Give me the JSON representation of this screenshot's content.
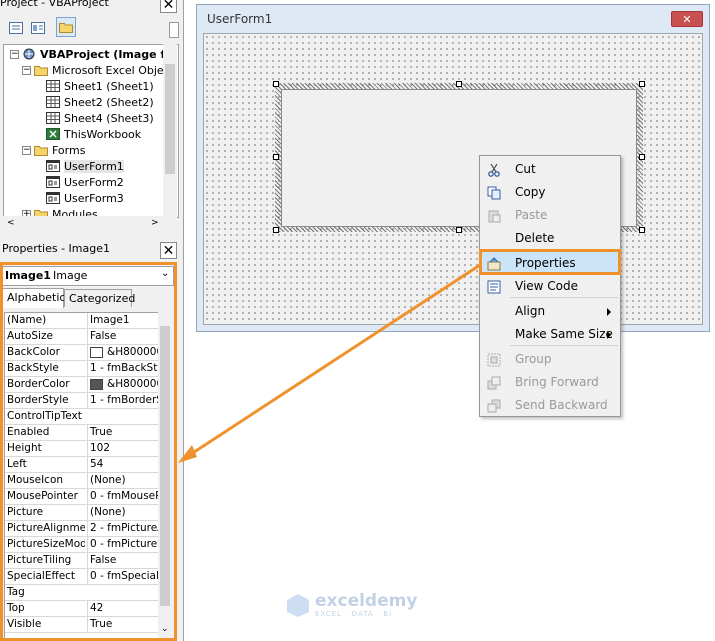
{
  "project": {
    "title": "Project - VBAProject",
    "tree": [
      {
        "label": "VBAProject (Image f",
        "icon": "vba-project-icon",
        "bold": true,
        "level": 0,
        "expander": "−"
      },
      {
        "label": "Microsoft Excel Obje",
        "icon": "folder-icon",
        "level": 1,
        "expander": "−"
      },
      {
        "label": "Sheet1 (Sheet1)",
        "icon": "sheet-icon",
        "level": 2
      },
      {
        "label": "Sheet2 (Sheet2)",
        "icon": "sheet-icon",
        "level": 2
      },
      {
        "label": "Sheet4 (Sheet3)",
        "icon": "sheet-icon",
        "level": 2
      },
      {
        "label": "ThisWorkbook",
        "icon": "workbook-icon",
        "level": 2
      },
      {
        "label": "Forms",
        "icon": "folder-icon",
        "level": 1,
        "expander": "−"
      },
      {
        "label": "UserForm1",
        "icon": "userform-icon",
        "level": 2
      },
      {
        "label": "UserForm2",
        "icon": "userform-icon",
        "level": 2
      },
      {
        "label": "UserForm3",
        "icon": "userform-icon",
        "level": 2
      },
      {
        "label": "Modules",
        "icon": "folder-icon",
        "level": 1,
        "expander": "+"
      }
    ]
  },
  "properties": {
    "title": "Properties - Image1",
    "object_name": "Image1",
    "object_type": "Image",
    "tabs": [
      "Alphabetic",
      "Categorized"
    ],
    "rows": [
      {
        "name": "(Name)",
        "value": "Image1"
      },
      {
        "name": "AutoSize",
        "value": "False"
      },
      {
        "name": "BackColor",
        "value": "&H8000000",
        "swatch": "#ffffff"
      },
      {
        "name": "BackStyle",
        "value": "1 - fmBackStyle"
      },
      {
        "name": "BorderColor",
        "value": "&H8000000",
        "swatch": "#555555"
      },
      {
        "name": "BorderStyle",
        "value": "1 - fmBorderSt"
      },
      {
        "name": "ControlTipText",
        "value": ""
      },
      {
        "name": "Enabled",
        "value": "True"
      },
      {
        "name": "Height",
        "value": "102"
      },
      {
        "name": "Left",
        "value": "54"
      },
      {
        "name": "MouseIcon",
        "value": "(None)"
      },
      {
        "name": "MousePointer",
        "value": "0 - fmMousePo"
      },
      {
        "name": "Picture",
        "value": "(None)"
      },
      {
        "name": "PictureAlignment",
        "value": "2 - fmPictureAl"
      },
      {
        "name": "PictureSizeMode",
        "value": "0 - fmPictureSi"
      },
      {
        "name": "PictureTiling",
        "value": "False"
      },
      {
        "name": "SpecialEffect",
        "value": "0 - fmSpecialEf"
      },
      {
        "name": "Tag",
        "value": ""
      },
      {
        "name": "Top",
        "value": "42"
      },
      {
        "name": "Visible",
        "value": "True"
      }
    ]
  },
  "userform": {
    "title": "UserForm1"
  },
  "context_menu": {
    "items": [
      {
        "label": "Cut",
        "icon": "scissors-icon",
        "enabled": true
      },
      {
        "label": "Copy",
        "icon": "copy-icon",
        "enabled": true
      },
      {
        "label": "Paste",
        "icon": "paste-icon",
        "enabled": false
      },
      {
        "label": "Delete",
        "icon": "",
        "enabled": true
      },
      {
        "label": "Properties",
        "icon": "properties-icon",
        "enabled": true,
        "highlighted": true
      },
      {
        "label": "View Code",
        "icon": "view-code-icon",
        "enabled": true
      },
      {
        "label": "Align",
        "icon": "",
        "enabled": true,
        "submenu": true
      },
      {
        "label": "Make Same Size",
        "icon": "",
        "enabled": true,
        "submenu": true
      },
      {
        "label": "Group",
        "icon": "group-icon",
        "enabled": false
      },
      {
        "label": "Bring Forward",
        "icon": "bring-forward-icon",
        "enabled": false
      },
      {
        "label": "Send Backward",
        "icon": "send-backward-icon",
        "enabled": false
      }
    ]
  },
  "watermark": {
    "brand": "exceldemy",
    "tagline": "EXCEL · DATA · BI"
  },
  "colors": {
    "highlight_orange": "#f0922b",
    "menu_highlight": "#cce4f7"
  }
}
